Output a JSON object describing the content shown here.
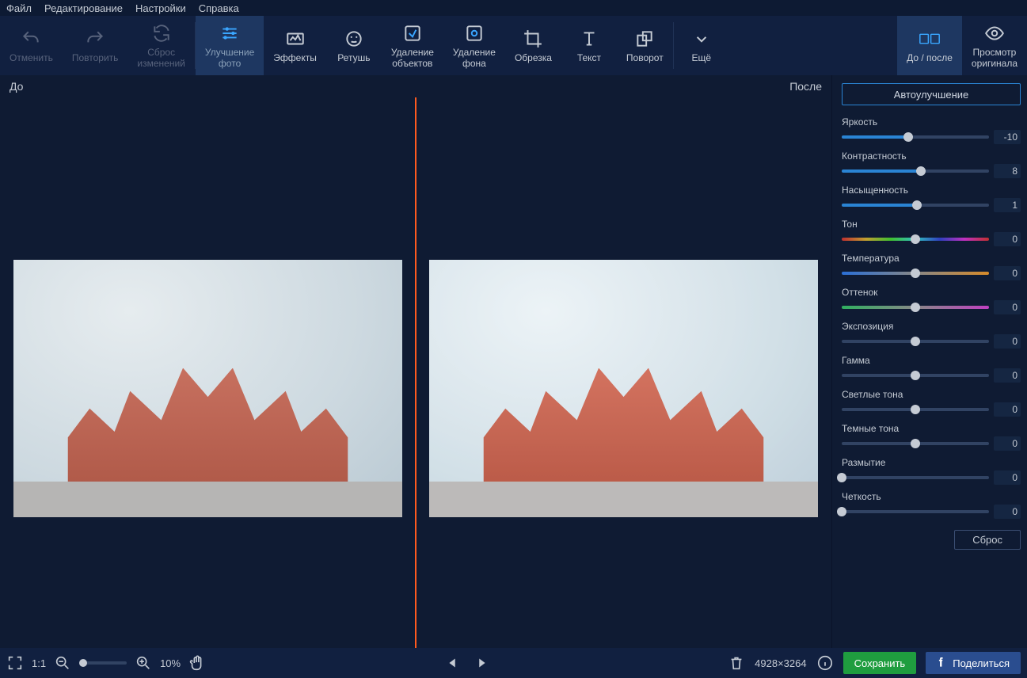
{
  "menu": {
    "file": "Файл",
    "edit": "Редактирование",
    "settings": "Настройки",
    "help": "Справка"
  },
  "toolbar": {
    "undo": "Отменить",
    "redo": "Повторить",
    "reset_changes_l1": "Сброс",
    "reset_changes_l2": "изменений",
    "enhance_l1": "Улучшение",
    "enhance_l2": "фото",
    "effects": "Эффекты",
    "retouch": "Ретушь",
    "remove_obj_l1": "Удаление",
    "remove_obj_l2": "объектов",
    "remove_bg_l1": "Удаление",
    "remove_bg_l2": "фона",
    "crop": "Обрезка",
    "text": "Текст",
    "rotate": "Поворот",
    "more": "Ещё",
    "before_after": "До / после",
    "view_original_l1": "Просмотр",
    "view_original_l2": "оригинала"
  },
  "canvas": {
    "before": "До",
    "after": "После"
  },
  "panel": {
    "auto": "Автоулучшение",
    "sliders": [
      {
        "label": "Яркость",
        "value": "-10",
        "pos": 45,
        "variant": "fill"
      },
      {
        "label": "Контрастность",
        "value": "8",
        "pos": 54,
        "variant": "fill"
      },
      {
        "label": "Насыщенность",
        "value": "1",
        "pos": 51,
        "variant": "fill"
      },
      {
        "label": "Тон",
        "value": "0",
        "pos": 50,
        "variant": "hue"
      },
      {
        "label": "Температура",
        "value": "0",
        "pos": 50,
        "variant": "temp"
      },
      {
        "label": "Оттенок",
        "value": "0",
        "pos": 50,
        "variant": "tint"
      },
      {
        "label": "Экспозиция",
        "value": "0",
        "pos": 50,
        "variant": "plain"
      },
      {
        "label": "Гамма",
        "value": "0",
        "pos": 50,
        "variant": "plain"
      },
      {
        "label": "Светлые тона",
        "value": "0",
        "pos": 50,
        "variant": "plain"
      },
      {
        "label": "Темные тона",
        "value": "0",
        "pos": 50,
        "variant": "plain"
      },
      {
        "label": "Размытие",
        "value": "0",
        "pos": 0,
        "variant": "plain"
      },
      {
        "label": "Четкость",
        "value": "0",
        "pos": 0,
        "variant": "plain"
      }
    ],
    "reset": "Сброс"
  },
  "footer": {
    "ratio": "1:1",
    "zoom_pct": "10%",
    "dimensions": "4928×3264",
    "save": "Сохранить",
    "share": "Поделиться"
  }
}
